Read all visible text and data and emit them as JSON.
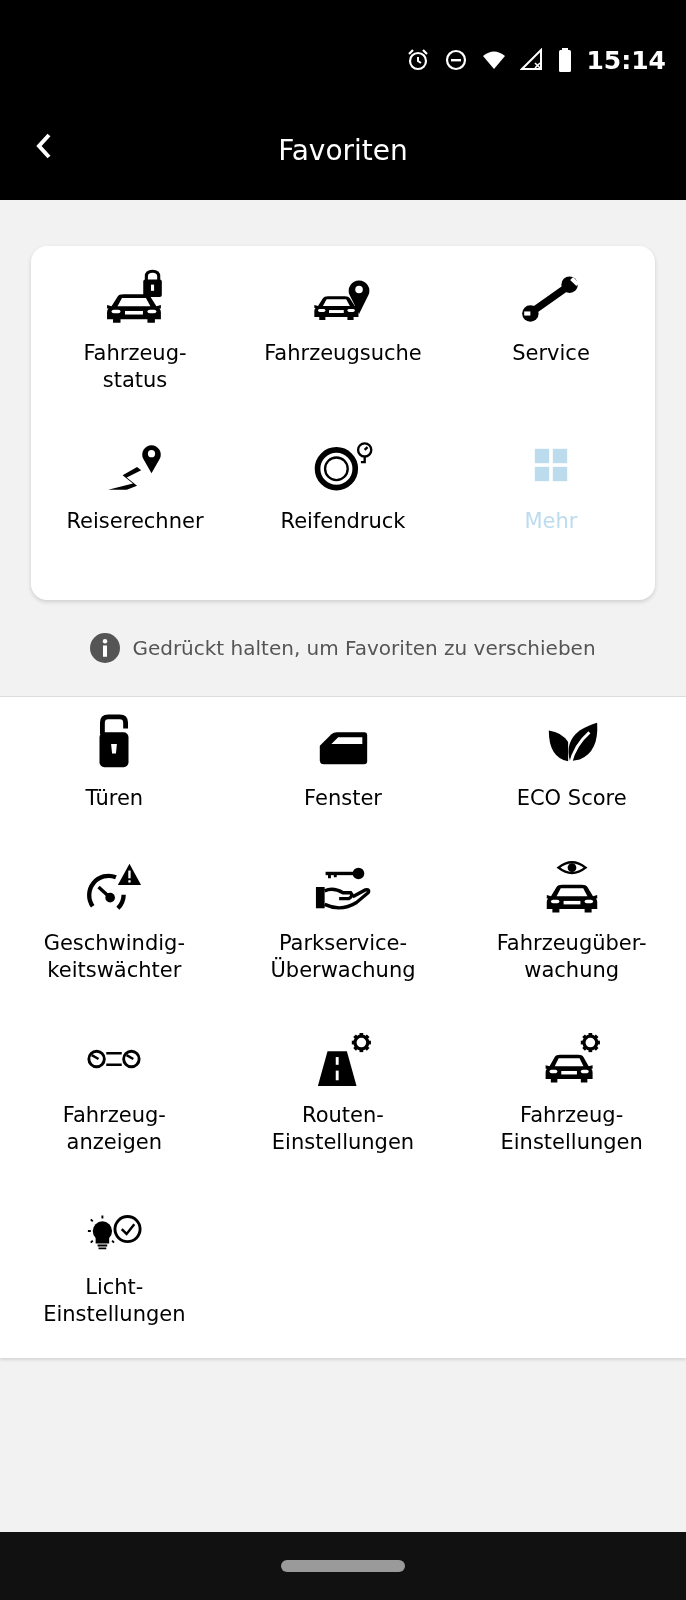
{
  "status_bar": {
    "time": "15:14"
  },
  "header": {
    "title": "Favoriten"
  },
  "favorites": [
    {
      "label": "Fahrzeug-\nstatus",
      "kind": "lock",
      "disabled": false
    },
    {
      "label": "Fahrzeugsuche",
      "kind": "locate",
      "disabled": false
    },
    {
      "label": "Service",
      "kind": "service",
      "disabled": false
    },
    {
      "label": "Reiserechner",
      "kind": "trip",
      "disabled": false
    },
    {
      "label": "Reifendruck",
      "kind": "tire",
      "disabled": false
    },
    {
      "label": "Mehr",
      "kind": "more",
      "disabled": true
    }
  ],
  "hint": "Gedrückt halten, um Favoriten zu verschieben",
  "functions": [
    {
      "label": "Türen",
      "kind": "doors"
    },
    {
      "label": "Fenster",
      "kind": "windows"
    },
    {
      "label": "ECO Score",
      "kind": "eco"
    },
    {
      "label": "Geschwindig-\nkeitswächter",
      "kind": "speed"
    },
    {
      "label": "Parkservice-\nÜberwachung",
      "kind": "valet"
    },
    {
      "label": "Fahrzeugüber-\nwachung",
      "kind": "watch"
    },
    {
      "label": "Fahrzeug-\nanzeigen",
      "kind": "displays"
    },
    {
      "label": "Routen-\nEinstellungen",
      "kind": "route"
    },
    {
      "label": "Fahrzeug-\nEinstellungen",
      "kind": "settings"
    },
    {
      "label": "Licht-\nEinstellungen",
      "kind": "light"
    }
  ]
}
